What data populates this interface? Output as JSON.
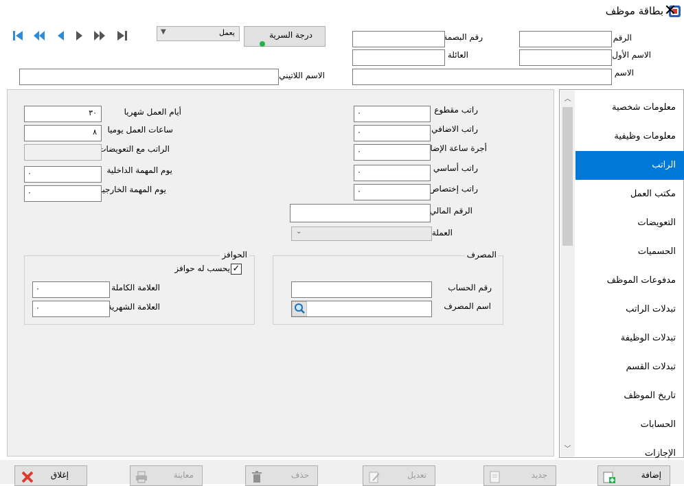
{
  "window": {
    "title": "بطاقة موظف",
    "close_glyph": "✕"
  },
  "header": {
    "number_label": "الرقم",
    "fingerprint_label": "رقم البصمة",
    "first_name_label": "الاسم الأول",
    "family_label": "العائلة",
    "name_label": "الاسم",
    "latin_name_label": "الاسم اللاتيني",
    "status_value": "يعمل",
    "nationality_button": "درجة السرية"
  },
  "salary": {
    "labels": {
      "piecework": "راتب مقطوع",
      "overtime_salary": "راتب الاضافي",
      "overtime_hour_wage": "أجرة ساعة الإضافي",
      "basic_salary": "راتب أساسي",
      "specialization_salary": "راتب إختصاص",
      "financial_number": "الرقم المالي",
      "currency": "العملة",
      "work_days_monthly": "أيام العمل شهريا",
      "work_hours_daily": "ساعات العمل يوميا",
      "salary_with_compensations": "الراتب مع التعويضات",
      "internal_mission_day": "يوم المهمة الداخلية",
      "external_mission_day": "يوم المهمة الخارجية"
    },
    "values": {
      "piecework": "٠",
      "overtime_salary": "٠",
      "overtime_hour_wage": "٠",
      "basic_salary": "٠",
      "specialization_salary": "٠",
      "work_days_monthly": "٣٠",
      "work_hours_daily": "٨",
      "internal_mission_day": "٠",
      "external_mission_day": "٠"
    }
  },
  "bank": {
    "title": "المصرف",
    "account_label": "رقم الحساب",
    "bank_name_label": "اسم المصرف"
  },
  "incentives": {
    "title": "الحوافز",
    "checkbox_label": "يحسب له حوافز",
    "checkbox_glyph": "✓",
    "full_mark_label": "العلامة الكاملة",
    "monthly_mark_label": "العلامة الشهرية",
    "full_mark_value": "٠",
    "monthly_mark_value": "٠"
  },
  "sidebar": {
    "items": [
      {
        "label": "معلومات شخصية"
      },
      {
        "label": "معلومات وظيفية"
      },
      {
        "label": "الراتب"
      },
      {
        "label": "مكتب العمل"
      },
      {
        "label": "التعويضات"
      },
      {
        "label": "الحسميات"
      },
      {
        "label": "مدفوعات الموظف"
      },
      {
        "label": "تبدلات الراتب"
      },
      {
        "label": "تبدلات الوظيفة"
      },
      {
        "label": "تبدلات القسم"
      },
      {
        "label": "تاريخ الموظف"
      },
      {
        "label": "الحسابات"
      },
      {
        "label": "الإجازات"
      }
    ],
    "active_index": 2
  },
  "buttons": {
    "add": "إضافة",
    "new": "جديد",
    "edit": "تعديل",
    "delete": "حذف",
    "preview": "معاينة",
    "close": "إغلاق"
  },
  "colors": {
    "accent": "#0078d7",
    "nav_blue": "#2e8bd8",
    "status_green": "#22b14c"
  }
}
